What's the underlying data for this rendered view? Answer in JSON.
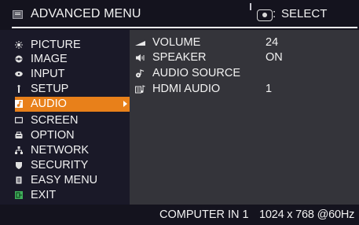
{
  "header": {
    "title": "ADVANCED MENU",
    "select_hint": "SELECT",
    "select_colon": ":"
  },
  "menu": {
    "items": [
      {
        "label": "PICTURE",
        "icon": "picture-icon"
      },
      {
        "label": "IMAGE",
        "icon": "image-icon"
      },
      {
        "label": "INPUT",
        "icon": "input-icon"
      },
      {
        "label": "SETUP",
        "icon": "setup-icon"
      },
      {
        "label": "AUDIO",
        "icon": "audio-icon",
        "selected": true
      },
      {
        "label": "SCREEN",
        "icon": "screen-icon"
      },
      {
        "label": "OPTION",
        "icon": "option-icon"
      },
      {
        "label": "NETWORK",
        "icon": "network-icon"
      },
      {
        "label": "SECURITY",
        "icon": "security-icon"
      },
      {
        "label": "EASY MENU",
        "icon": "easy-menu-icon"
      },
      {
        "label": "EXIT",
        "icon": "exit-icon"
      }
    ]
  },
  "audio": {
    "rows": [
      {
        "label": "VOLUME",
        "value": "24",
        "icon": "volume-icon"
      },
      {
        "label": "SPEAKER",
        "value": "ON",
        "icon": "speaker-icon"
      },
      {
        "label": "AUDIO SOURCE",
        "value": "",
        "icon": "audio-source-icon"
      },
      {
        "label": "HDMI AUDIO",
        "value": "1",
        "icon": "hdmi-audio-icon"
      }
    ]
  },
  "status": {
    "input": "COMPUTER IN 1",
    "signal": "1024 x 768 @60Hz"
  },
  "colors": {
    "highlight": "#e8801a",
    "panel": "#34343a",
    "menu_bg": "#1a1928"
  }
}
